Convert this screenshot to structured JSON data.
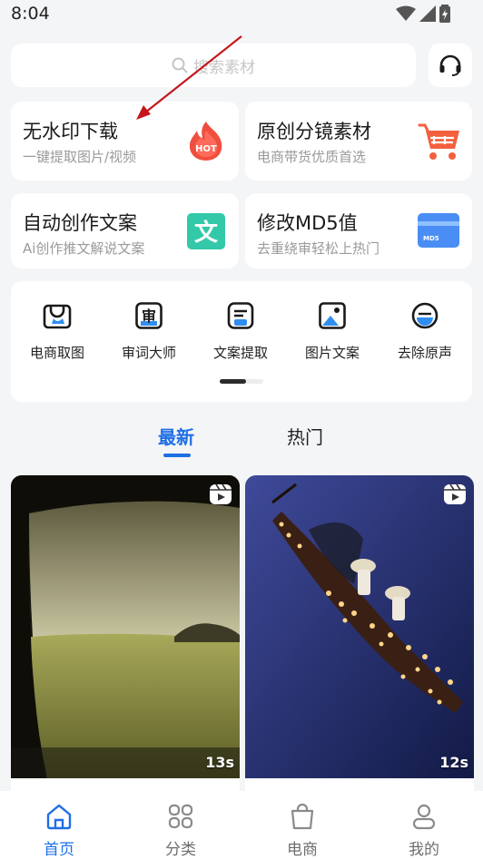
{
  "status_bar": {
    "time": "8:04"
  },
  "search": {
    "placeholder": "搜索素材"
  },
  "feature_cards": [
    {
      "title": "无水印下载",
      "subtitle": "一键提取图片/视频",
      "icon": "hot-flame-icon",
      "badge": "HOT"
    },
    {
      "title": "原创分镜素材",
      "subtitle": "电商带货优质首选",
      "icon": "shopping-cart-icon"
    },
    {
      "title": "自动创作文案",
      "subtitle": "Ai创作推文解说文案",
      "icon": "text-wen-icon",
      "badge": "文"
    },
    {
      "title": "修改MD5值",
      "subtitle": "去重绕审轻松上热门",
      "icon": "md5-card-icon",
      "badge": "MD5"
    }
  ],
  "tools": [
    {
      "label": "电商取图",
      "icon": "shop-bag-icon"
    },
    {
      "label": "审词大师",
      "icon": "review-word-icon",
      "glyph": "审"
    },
    {
      "label": "文案提取",
      "icon": "copy-extract-icon"
    },
    {
      "label": "图片文案",
      "icon": "image-text-icon"
    },
    {
      "label": "去除原声",
      "icon": "remove-audio-icon"
    }
  ],
  "tabs": [
    {
      "label": "最新",
      "active": true
    },
    {
      "label": "热门",
      "active": false
    }
  ],
  "videos": [
    {
      "duration": "13s"
    },
    {
      "duration": "12s"
    }
  ],
  "bottom_nav": [
    {
      "label": "首页",
      "icon": "home-icon",
      "active": true
    },
    {
      "label": "分类",
      "icon": "category-grid-icon",
      "active": false
    },
    {
      "label": "电商",
      "icon": "shopping-bag-icon",
      "active": false
    },
    {
      "label": "我的",
      "icon": "profile-icon",
      "active": false
    }
  ],
  "colors": {
    "accent": "#1f6fe5",
    "hot": "#f04e3e",
    "cart": "#f2603d",
    "wen": "#33c9a8",
    "md5": "#4a8df5"
  }
}
